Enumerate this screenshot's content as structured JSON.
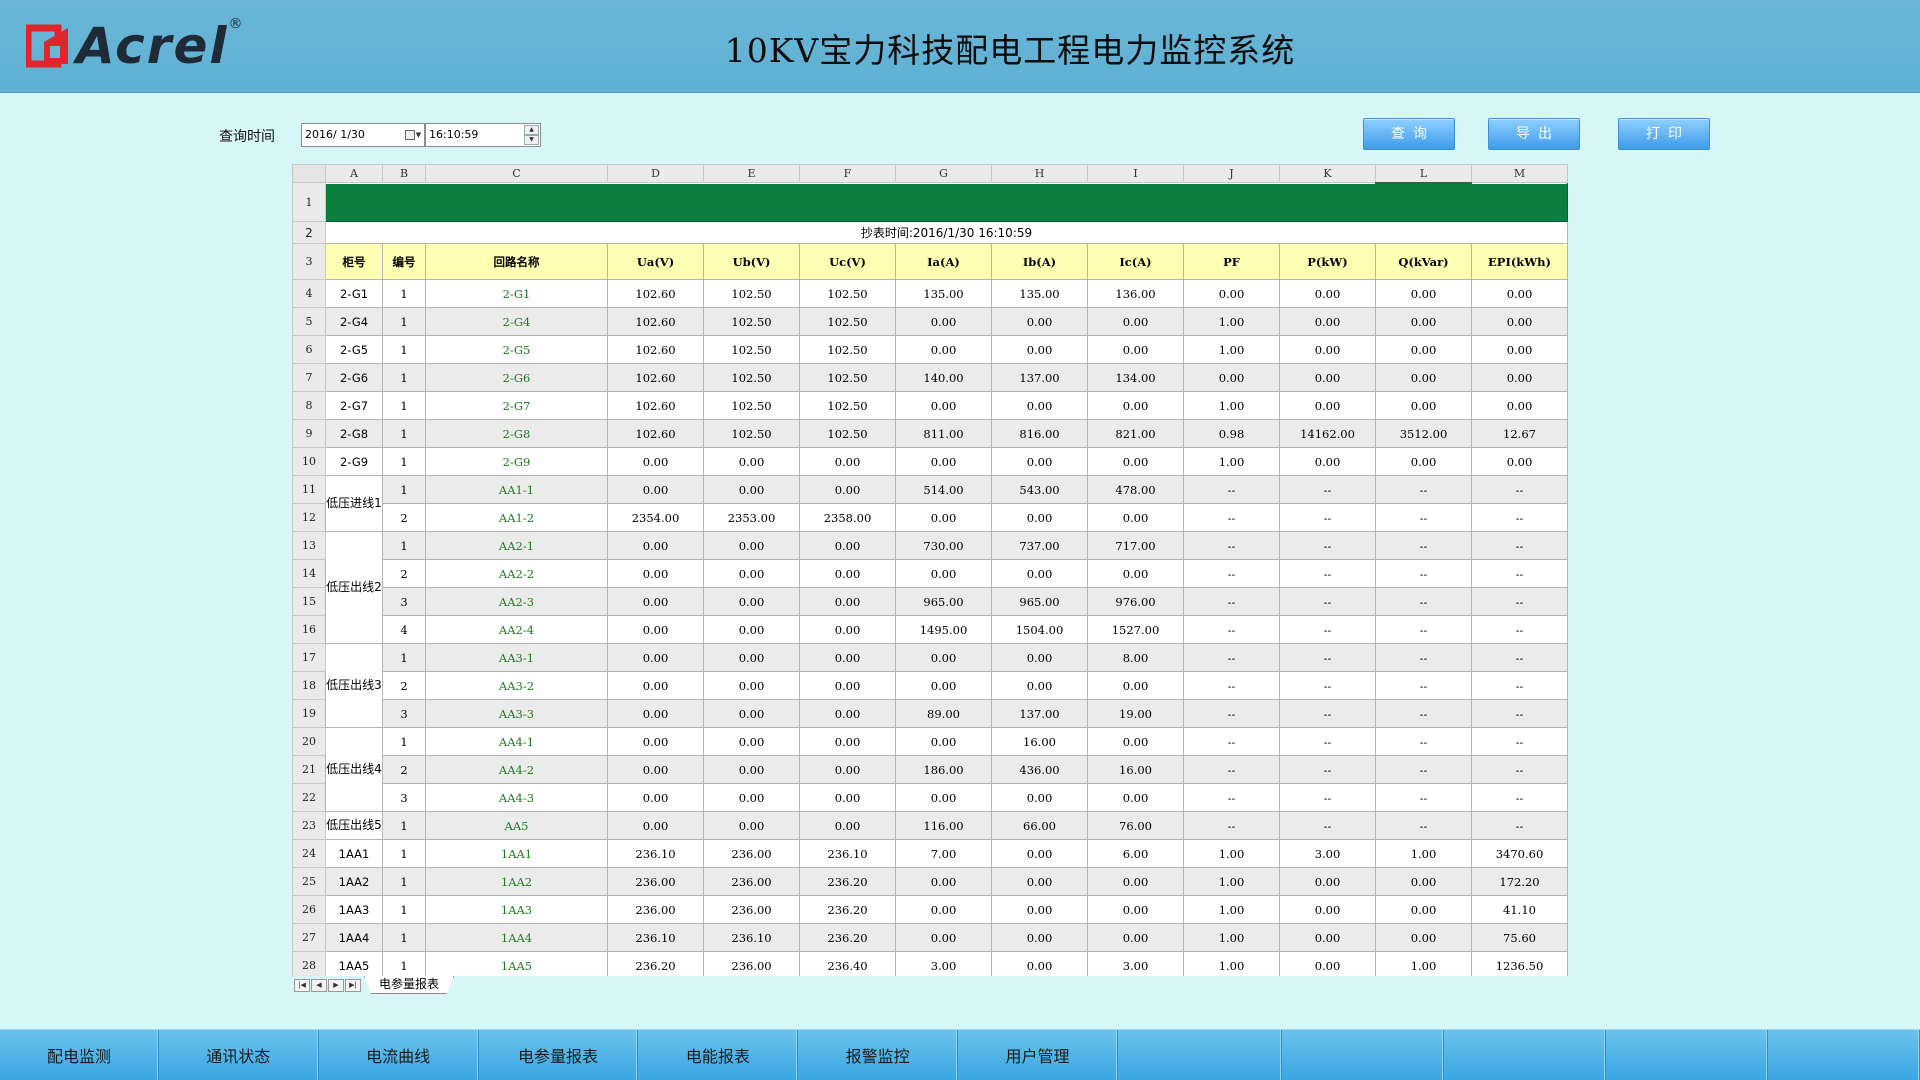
{
  "header": {
    "logo_text": "Acrel",
    "logo_reg": "®",
    "title": "10KV宝力科技配电工程电力监控系统",
    "brand_color": "#e0262c"
  },
  "query": {
    "label": "查询时间",
    "date_value": "2016/ 1/30",
    "time_value": "16:10:59",
    "buttons": {
      "query": "查询",
      "export": "导出",
      "print": "打印"
    }
  },
  "sheet": {
    "col_letters": [
      "A",
      "B",
      "C",
      "D",
      "E",
      "F",
      "G",
      "H",
      "I",
      "J",
      "K",
      "L",
      "M"
    ],
    "selected_col": "L",
    "row_numbers": [
      "1",
      "2",
      "3",
      "4",
      "5",
      "6",
      "7",
      "8",
      "9",
      "10",
      "11",
      "12",
      "13",
      "14",
      "15",
      "16",
      "17",
      "18",
      "19",
      "20",
      "21",
      "22",
      "23",
      "24",
      "25",
      "26",
      "27",
      "28"
    ],
    "timestamp": "抄表时间:2016/1/30 16:10:59",
    "headers": [
      "柜号",
      "编号",
      "回路名称",
      "Ua(V)",
      "Ub(V)",
      "Uc(V)",
      "Ia(A)",
      "Ib(A)",
      "Ic(A)",
      "PF",
      "P(kW)",
      "Q(kVar)",
      "EPI(kWh)"
    ],
    "rows": [
      [
        "2-G1",
        "1",
        "2-G1",
        "102.60",
        "102.50",
        "102.50",
        "135.00",
        "135.00",
        "136.00",
        "0.00",
        "0.00",
        "0.00",
        "0.00"
      ],
      [
        "2-G4",
        "1",
        "2-G4",
        "102.60",
        "102.50",
        "102.50",
        "0.00",
        "0.00",
        "0.00",
        "1.00",
        "0.00",
        "0.00",
        "0.00"
      ],
      [
        "2-G5",
        "1",
        "2-G5",
        "102.60",
        "102.50",
        "102.50",
        "0.00",
        "0.00",
        "0.00",
        "1.00",
        "0.00",
        "0.00",
        "0.00"
      ],
      [
        "2-G6",
        "1",
        "2-G6",
        "102.60",
        "102.50",
        "102.50",
        "140.00",
        "137.00",
        "134.00",
        "0.00",
        "0.00",
        "0.00",
        "0.00"
      ],
      [
        "2-G7",
        "1",
        "2-G7",
        "102.60",
        "102.50",
        "102.50",
        "0.00",
        "0.00",
        "0.00",
        "1.00",
        "0.00",
        "0.00",
        "0.00"
      ],
      [
        "2-G8",
        "1",
        "2-G8",
        "102.60",
        "102.50",
        "102.50",
        "811.00",
        "816.00",
        "821.00",
        "0.98",
        "14162.00",
        "3512.00",
        "12.67"
      ],
      [
        "2-G9",
        "1",
        "2-G9",
        "0.00",
        "0.00",
        "0.00",
        "0.00",
        "0.00",
        "0.00",
        "1.00",
        "0.00",
        "0.00",
        "0.00"
      ],
      [
        "低压进线1",
        "1",
        "AA1-1",
        "0.00",
        "0.00",
        "0.00",
        "514.00",
        "543.00",
        "478.00",
        "--",
        "--",
        "--",
        "--"
      ],
      [
        null,
        "2",
        "AA1-2",
        "2354.00",
        "2353.00",
        "2358.00",
        "0.00",
        "0.00",
        "0.00",
        "--",
        "--",
        "--",
        "--"
      ],
      [
        "低压出线2",
        "1",
        "AA2-1",
        "0.00",
        "0.00",
        "0.00",
        "730.00",
        "737.00",
        "717.00",
        "--",
        "--",
        "--",
        "--"
      ],
      [
        null,
        "2",
        "AA2-2",
        "0.00",
        "0.00",
        "0.00",
        "0.00",
        "0.00",
        "0.00",
        "--",
        "--",
        "--",
        "--"
      ],
      [
        null,
        "3",
        "AA2-3",
        "0.00",
        "0.00",
        "0.00",
        "965.00",
        "965.00",
        "976.00",
        "--",
        "--",
        "--",
        "--"
      ],
      [
        null,
        "4",
        "AA2-4",
        "0.00",
        "0.00",
        "0.00",
        "1495.00",
        "1504.00",
        "1527.00",
        "--",
        "--",
        "--",
        "--"
      ],
      [
        "低压出线3",
        "1",
        "AA3-1",
        "0.00",
        "0.00",
        "0.00",
        "0.00",
        "0.00",
        "8.00",
        "--",
        "--",
        "--",
        "--"
      ],
      [
        null,
        "2",
        "AA3-2",
        "0.00",
        "0.00",
        "0.00",
        "0.00",
        "0.00",
        "0.00",
        "--",
        "--",
        "--",
        "--"
      ],
      [
        null,
        "3",
        "AA3-3",
        "0.00",
        "0.00",
        "0.00",
        "89.00",
        "137.00",
        "19.00",
        "--",
        "--",
        "--",
        "--"
      ],
      [
        "低压出线4",
        "1",
        "AA4-1",
        "0.00",
        "0.00",
        "0.00",
        "0.00",
        "16.00",
        "0.00",
        "--",
        "--",
        "--",
        "--"
      ],
      [
        null,
        "2",
        "AA4-2",
        "0.00",
        "0.00",
        "0.00",
        "186.00",
        "436.00",
        "16.00",
        "--",
        "--",
        "--",
        "--"
      ],
      [
        null,
        "3",
        "AA4-3",
        "0.00",
        "0.00",
        "0.00",
        "0.00",
        "0.00",
        "0.00",
        "--",
        "--",
        "--",
        "--"
      ],
      [
        "低压出线5",
        "1",
        "AA5",
        "0.00",
        "0.00",
        "0.00",
        "116.00",
        "66.00",
        "76.00",
        "--",
        "--",
        "--",
        "--"
      ],
      [
        "1AA1",
        "1",
        "1AA1",
        "236.10",
        "236.00",
        "236.10",
        "7.00",
        "0.00",
        "6.00",
        "1.00",
        "3.00",
        "1.00",
        "3470.60"
      ],
      [
        "1AA2",
        "1",
        "1AA2",
        "236.00",
        "236.00",
        "236.20",
        "0.00",
        "0.00",
        "0.00",
        "1.00",
        "0.00",
        "0.00",
        "172.20"
      ],
      [
        "1AA3",
        "1",
        "1AA3",
        "236.00",
        "236.00",
        "236.20",
        "0.00",
        "0.00",
        "0.00",
        "1.00",
        "0.00",
        "0.00",
        "41.10"
      ],
      [
        "1AA4",
        "1",
        "1AA4",
        "236.10",
        "236.10",
        "236.20",
        "0.00",
        "0.00",
        "0.00",
        "1.00",
        "0.00",
        "0.00",
        "75.60"
      ],
      [
        "1AA5",
        "1",
        "1AA5",
        "236.20",
        "236.00",
        "236.40",
        "3.00",
        "0.00",
        "3.00",
        "1.00",
        "0.00",
        "1.00",
        "1236.50"
      ]
    ],
    "group_spans": [
      1,
      1,
      1,
      1,
      1,
      1,
      1,
      2,
      0,
      4,
      0,
      0,
      0,
      3,
      0,
      0,
      3,
      0,
      0,
      1,
      1,
      1,
      1,
      1,
      1
    ],
    "tab_label": "电参量报表",
    "tab_nav": [
      "|◀",
      "◀",
      "▶",
      "▶|"
    ]
  },
  "bottom_nav": [
    "配电监测",
    "通讯状态",
    "电流曲线",
    "电参量报表",
    "电能报表",
    "报警监控",
    "用户管理",
    "",
    "",
    "",
    "",
    ""
  ]
}
